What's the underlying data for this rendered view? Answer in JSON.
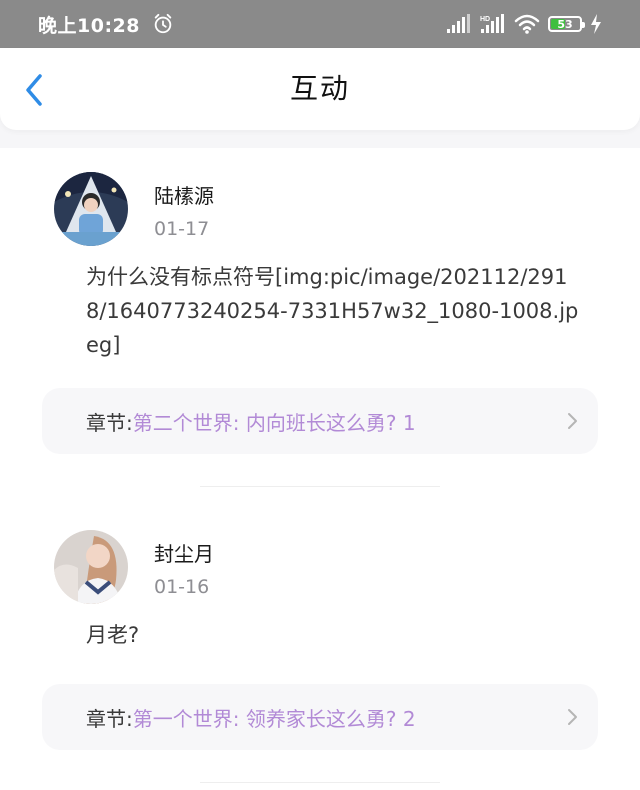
{
  "status_bar": {
    "time": "晚上10:28",
    "battery_level": "53",
    "battery_fraction": 0.53
  },
  "header": {
    "title": "互动"
  },
  "comments": [
    {
      "username": "陆榡源",
      "date": "01-17",
      "text": "为什么没有标点符号[img:pic/image/202112/2918/1640773240254-7331H57w32_1080-1008.jpeg]",
      "chapter_label": "章节:",
      "chapter_title": "第二个世界: 内向班长这么勇? 1"
    },
    {
      "username": "封尘月",
      "date": "01-16",
      "text": "月老?",
      "chapter_label": "章节:",
      "chapter_title": "第一个世界: 领养家长这么勇? 2"
    }
  ],
  "colors": {
    "accent_back": "#2f8ce6",
    "chapter_link": "#b28ad6",
    "status_bar_bg": "#8a8a8a"
  },
  "icons": {
    "back": "chevron-left-icon",
    "chapter_arrow": "chevron-right-icon",
    "alarm": "alarm-icon",
    "signal": "signal-icon",
    "wifi": "wifi-icon",
    "battery": "battery-icon",
    "charging": "bolt-icon"
  }
}
